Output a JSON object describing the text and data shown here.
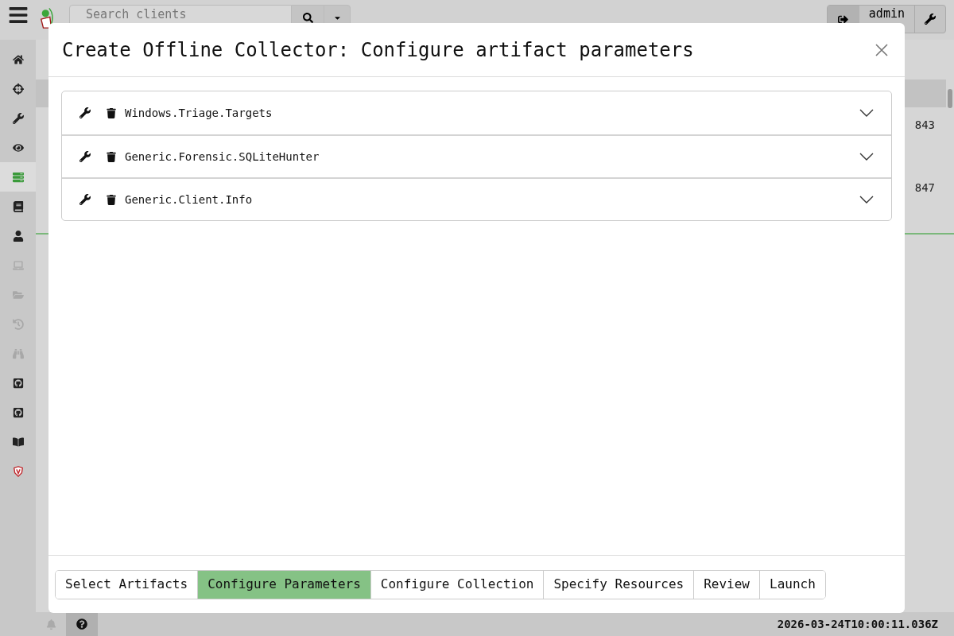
{
  "topbar": {
    "search": {
      "placeholder": "Search clients"
    },
    "user": "admin"
  },
  "sidebar": {
    "items": [
      {
        "selected": false,
        "disabled": false
      },
      {
        "selected": false,
        "disabled": false
      },
      {
        "selected": false,
        "disabled": false
      },
      {
        "selected": false,
        "disabled": false
      },
      {
        "selected": true,
        "disabled": false
      },
      {
        "selected": false,
        "disabled": false
      },
      {
        "selected": false,
        "disabled": false
      },
      {
        "selected": false,
        "disabled": true
      },
      {
        "selected": false,
        "disabled": true
      },
      {
        "selected": false,
        "disabled": true
      },
      {
        "selected": false,
        "disabled": true
      },
      {
        "selected": false,
        "disabled": false
      },
      {
        "selected": false,
        "disabled": false
      },
      {
        "selected": false,
        "disabled": false
      },
      {
        "selected": false,
        "disabled": false
      }
    ]
  },
  "table": {
    "rows": [
      {
        "column_2": "843"
      },
      {
        "column_2": "847"
      }
    ]
  },
  "status_bar": {
    "time": "2026-03-24T10:00:11.036Z"
  },
  "dialog": {
    "title": "Create Offline Collector: Configure artifact parameters",
    "artifacts": [
      {
        "name": "Windows.Triage.Targets",
        "expanded": false
      },
      {
        "name": "Generic.Forensic.SQLiteHunter",
        "expanded": false
      },
      {
        "name": "Generic.Client.Info",
        "expanded": false
      }
    ],
    "steps": [
      {
        "label": "Select Artifacts",
        "selected": false
      },
      {
        "label": "Configure Parameters",
        "selected": true
      },
      {
        "label": "Configure Collection",
        "selected": false
      },
      {
        "label": "Specify Resources",
        "selected": false
      },
      {
        "label": "Review",
        "selected": false
      },
      {
        "label": "Launch",
        "selected": false
      }
    ]
  }
}
